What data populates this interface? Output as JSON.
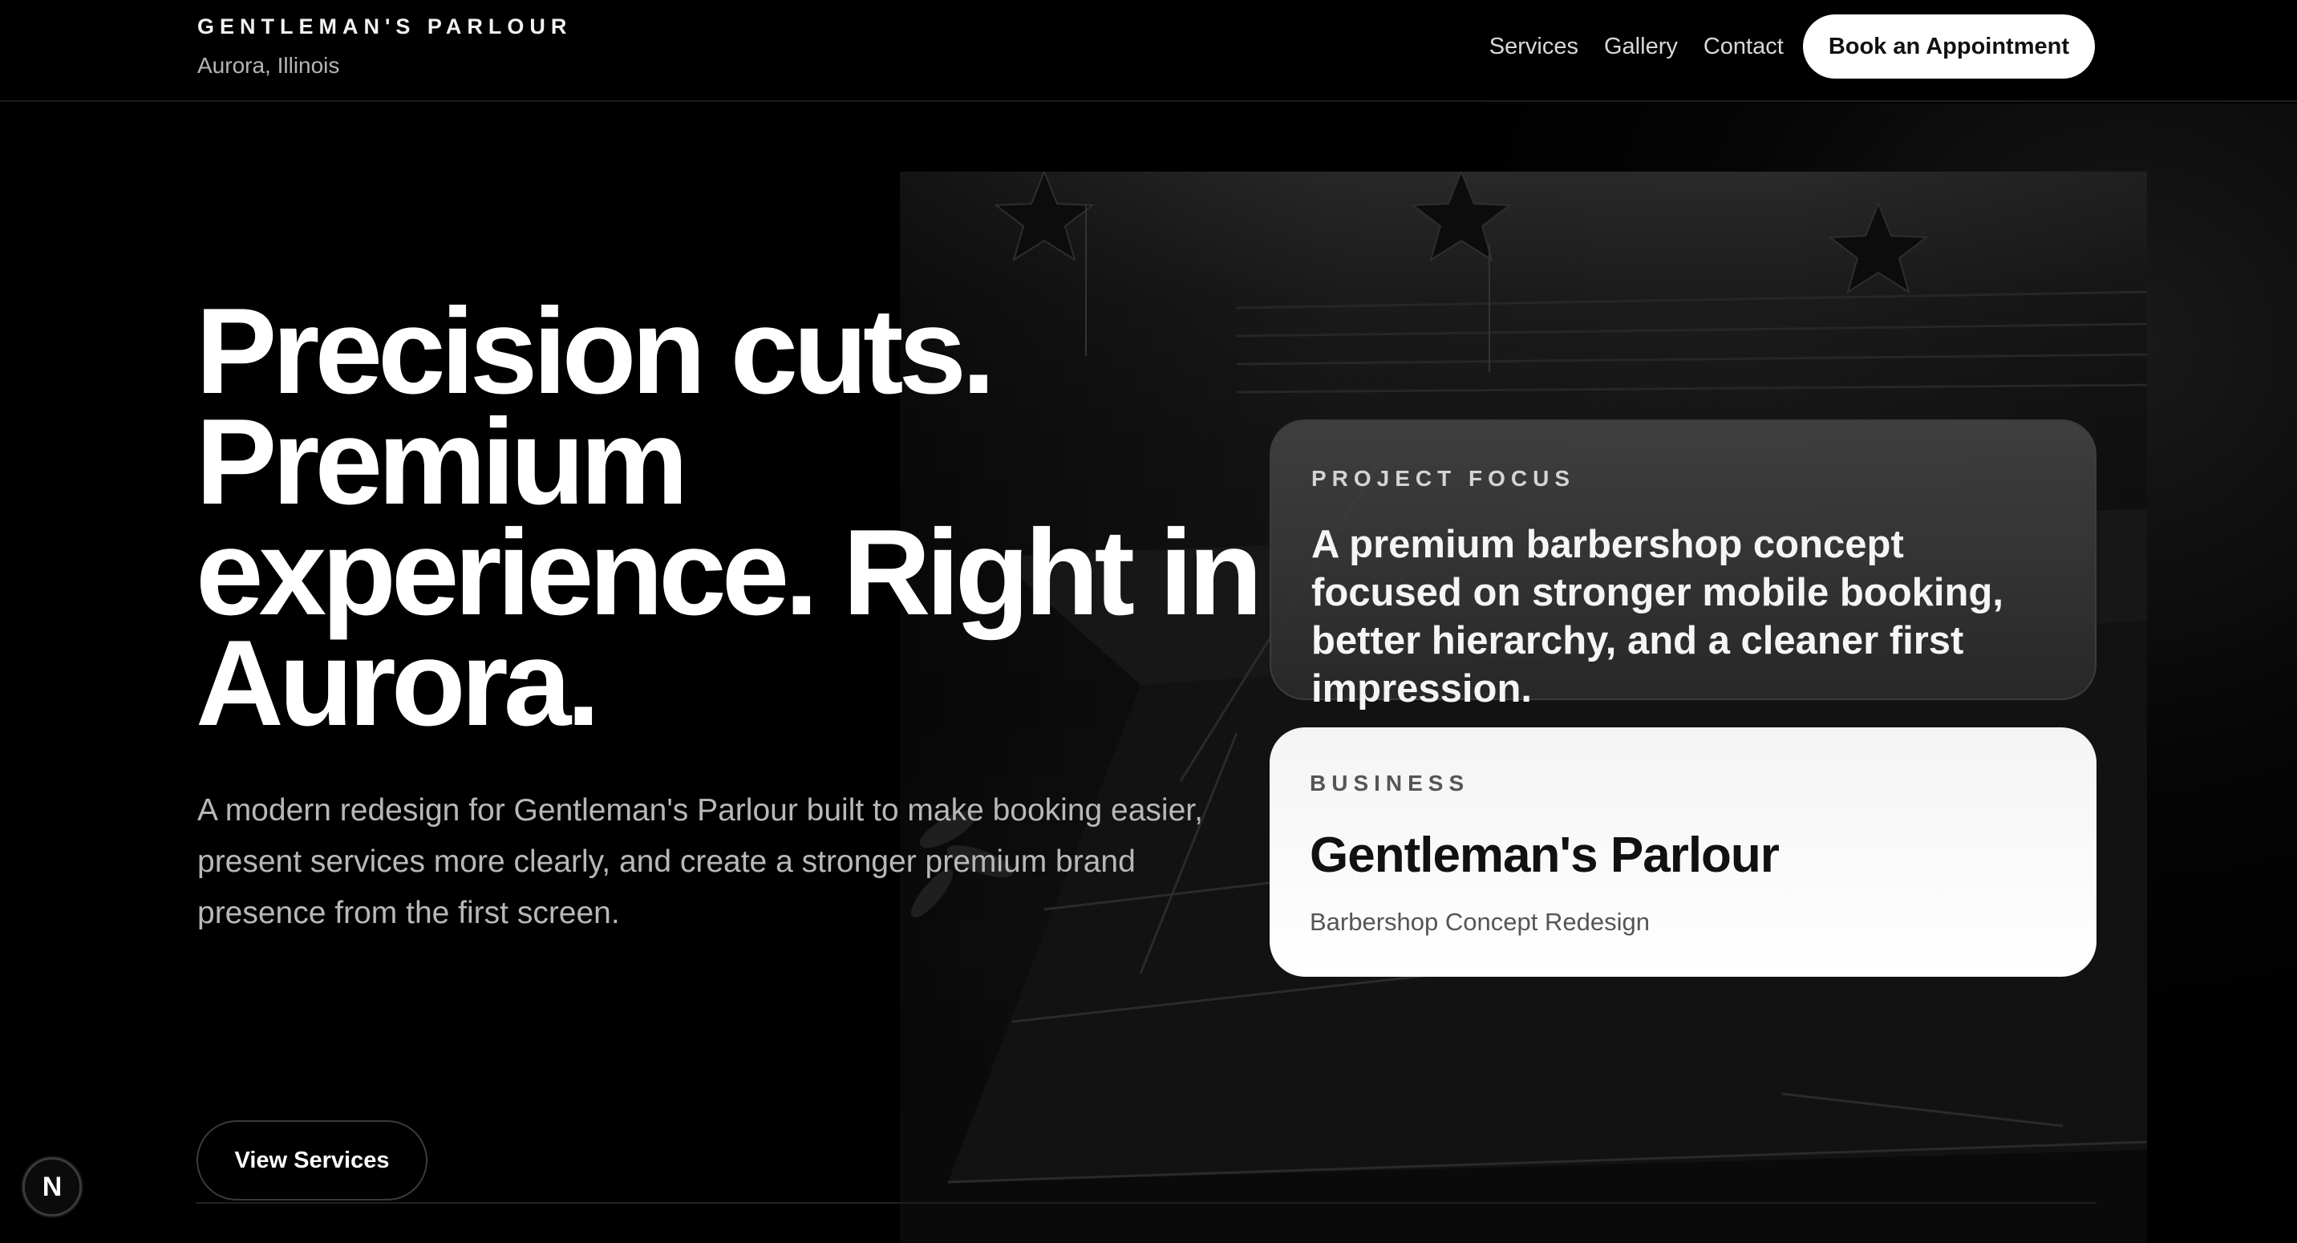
{
  "header": {
    "brand_name": "GENTLEMAN'S PARLOUR",
    "brand_location": "Aurora, Illinois",
    "nav": [
      "Services",
      "Gallery",
      "Contact"
    ],
    "cta_label": "Book an Appointment"
  },
  "hero": {
    "headline_lines": [
      "Precision cuts.",
      "Premium",
      "experience. Right in",
      "Aurora."
    ],
    "lede": "A modern redesign for Gentleman's Parlour built to make booking easier, present services more clearly, and create a stronger premium brand presence from the first screen.",
    "secondary_cta": "View Services",
    "background_image": "barbershop-interior-photo"
  },
  "cards": {
    "focus": {
      "label": "PROJECT FOCUS",
      "text": "A premium barbershop concept focused on stronger mobile booking, better hierarchy, and a cleaner first impression."
    },
    "business": {
      "label": "BUSINESS",
      "name": "Gentleman's Parlour",
      "subtitle": "Barbershop Concept Redesign"
    }
  },
  "badge": {
    "letter": "N",
    "icon": "nextjs-dev-indicator-icon"
  },
  "colors": {
    "background": "#000000",
    "text_primary": "#ffffff",
    "text_muted": "#b8b8b8",
    "card_light": "#ffffff",
    "card_dark": "#2a2a2a"
  }
}
